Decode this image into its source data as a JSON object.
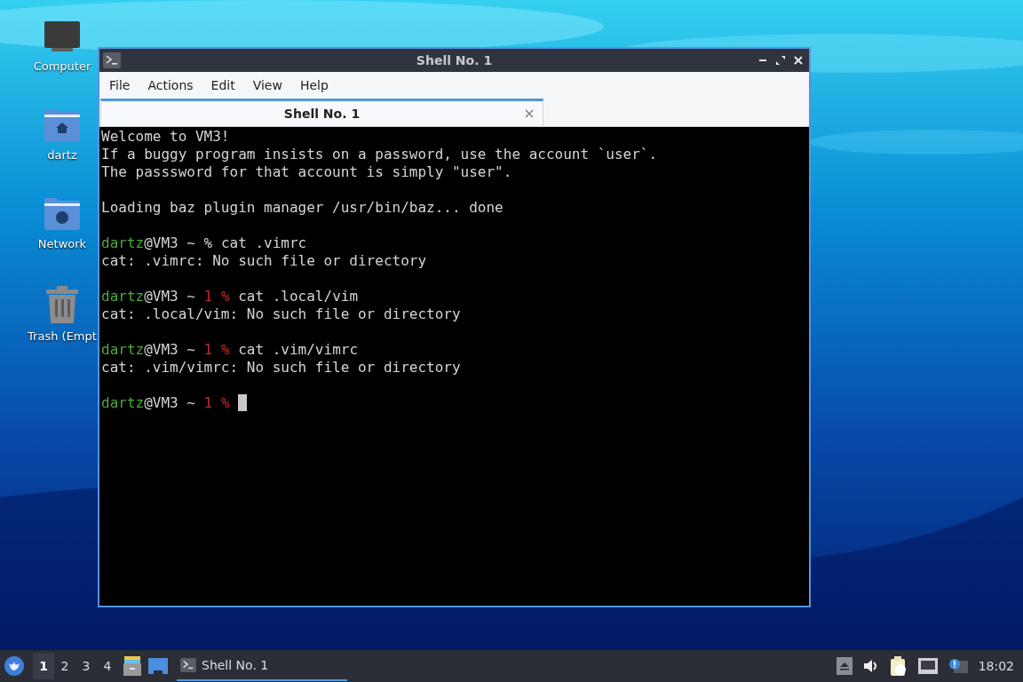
{
  "desktop_icons": [
    {
      "kind": "computer",
      "label": "Computer"
    },
    {
      "kind": "home",
      "label": "dartz"
    },
    {
      "kind": "network",
      "label": "Network"
    },
    {
      "kind": "trash",
      "label": "Trash (Empt"
    }
  ],
  "window": {
    "title": "Shell No. 1",
    "menu": [
      "File",
      "Actions",
      "Edit",
      "View",
      "Help"
    ],
    "tabs": [
      {
        "label": "Shell No. 1",
        "selected": true
      }
    ],
    "terminal": [
      {
        "kind": "output",
        "text": "Welcome to VM3!"
      },
      {
        "kind": "output",
        "text": "If a buggy program insists on a password, use the account `user`."
      },
      {
        "kind": "output",
        "text": "The passsword for that account is simply \"user\"."
      },
      {
        "kind": "blank"
      },
      {
        "kind": "output",
        "text": "Loading baz plugin manager /usr/bin/baz... done"
      },
      {
        "kind": "blank"
      },
      {
        "kind": "prompt",
        "user": "dartz",
        "host": "@VM3 ~",
        "sign": "%",
        "command": "cat .vimrc"
      },
      {
        "kind": "output",
        "text": "cat: .vimrc: No such file or directory"
      },
      {
        "kind": "blank"
      },
      {
        "kind": "prompt",
        "user": "dartz",
        "host": "@VM3 ~",
        "exit_code": "1",
        "sign": "%",
        "command": "cat .local/vim"
      },
      {
        "kind": "output",
        "text": "cat: .local/vim: No such file or directory"
      },
      {
        "kind": "blank"
      },
      {
        "kind": "prompt",
        "user": "dartz",
        "host": "@VM3 ~",
        "exit_code": "1",
        "sign": "%",
        "command": "cat .vim/vimrc"
      },
      {
        "kind": "output",
        "text": "cat: .vim/vimrc: No such file or directory"
      },
      {
        "kind": "blank"
      },
      {
        "kind": "prompt",
        "user": "dartz",
        "host": "@VM3 ~",
        "exit_code": "1",
        "sign": "%",
        "cursor": true
      }
    ]
  },
  "taskbar": {
    "workspaces": [
      {
        "label": "1",
        "selected": true
      },
      {
        "label": "2",
        "selected": false
      },
      {
        "label": "3",
        "selected": false
      },
      {
        "label": "4",
        "selected": false
      }
    ],
    "tasks": [
      {
        "label": "Shell No. 1",
        "selected": true
      }
    ],
    "clock": "18:02"
  }
}
